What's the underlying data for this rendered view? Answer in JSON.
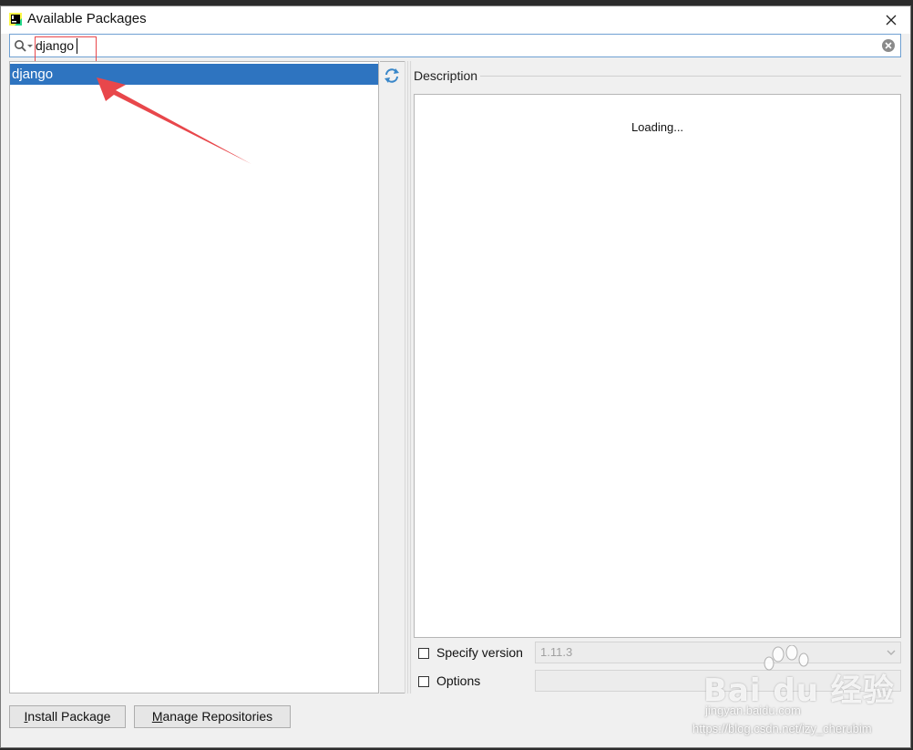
{
  "window": {
    "title": "Available Packages",
    "app_icon": "pycharm-logo-icon",
    "close_icon": "close-icon"
  },
  "search": {
    "value": "django",
    "search_icon": "search-icon",
    "clear_icon": "clear-circle-icon"
  },
  "packages": {
    "items": [
      {
        "label": "django",
        "selected": true
      }
    ],
    "refresh_icon": "refresh-icon"
  },
  "description": {
    "label": "Description",
    "body": "Loading..."
  },
  "options": {
    "specify_version": {
      "label": "Specify version",
      "checked": false
    },
    "version_value": "1.11.3",
    "options": {
      "label": "Options",
      "checked": false
    }
  },
  "buttons": {
    "install": {
      "mnemonic": "I",
      "rest": "nstall Package"
    },
    "manage": {
      "mnemonic": "M",
      "rest": "anage Repositories"
    }
  },
  "watermark": {
    "logo": "Bai du 经验",
    "site": "jingyan.baidu.com",
    "url": "https://blog.csdn.net/izy_cherubim"
  },
  "colors": {
    "selection": "#2e74c0",
    "annotation_red": "#e8474b",
    "focus_border": "#6fa0d2"
  }
}
